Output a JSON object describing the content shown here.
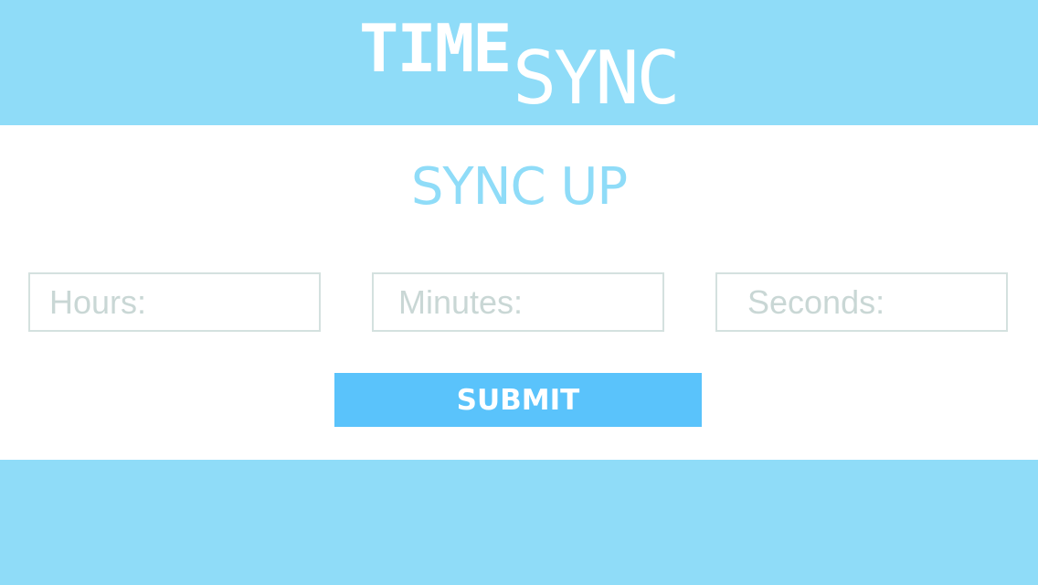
{
  "header": {
    "logo_time": "TIME",
    "logo_sync": "SYNC"
  },
  "main": {
    "title": "SYNC UP",
    "fields": {
      "hours_placeholder": "Hours:",
      "minutes_placeholder": "Minutes:",
      "seconds_placeholder": "Seconds:"
    },
    "submit_label": "SUBMIT"
  },
  "colors": {
    "brand_light_blue": "#8fdcf8",
    "button_blue": "#5ac3fb",
    "field_border": "#d4e1df",
    "placeholder_text": "#c9d7d5",
    "background": "#ffffff"
  }
}
